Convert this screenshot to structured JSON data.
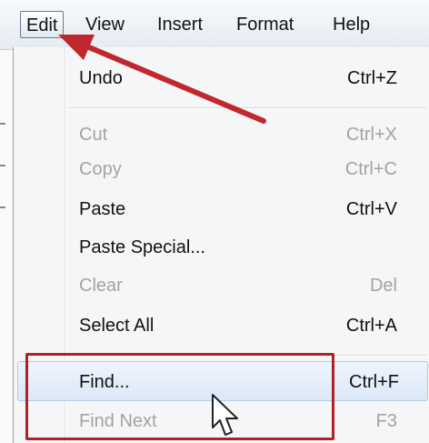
{
  "menubar": {
    "items": [
      {
        "label": "Edit"
      },
      {
        "label": "View"
      },
      {
        "label": "Insert"
      },
      {
        "label": "Format"
      },
      {
        "label": "Help"
      }
    ]
  },
  "edit_menu": {
    "items": [
      {
        "label": "Undo",
        "shortcut": "Ctrl+Z",
        "enabled": true
      },
      {
        "label": "Cut",
        "shortcut": "Ctrl+X",
        "enabled": false
      },
      {
        "label": "Copy",
        "shortcut": "Ctrl+C",
        "enabled": false
      },
      {
        "label": "Paste",
        "shortcut": "Ctrl+V",
        "enabled": true
      },
      {
        "label": "Paste Special...",
        "shortcut": "",
        "enabled": true
      },
      {
        "label": "Clear",
        "shortcut": "Del",
        "enabled": false
      },
      {
        "label": "Select All",
        "shortcut": "Ctrl+A",
        "enabled": true
      },
      {
        "label": "Find...",
        "shortcut": "Ctrl+F",
        "enabled": true,
        "hovered": true
      },
      {
        "label": "Find Next",
        "shortcut": "F3",
        "enabled": false
      }
    ]
  },
  "annotations": {
    "arrow_color": "#c0282d",
    "box_color": "#b51f24"
  }
}
